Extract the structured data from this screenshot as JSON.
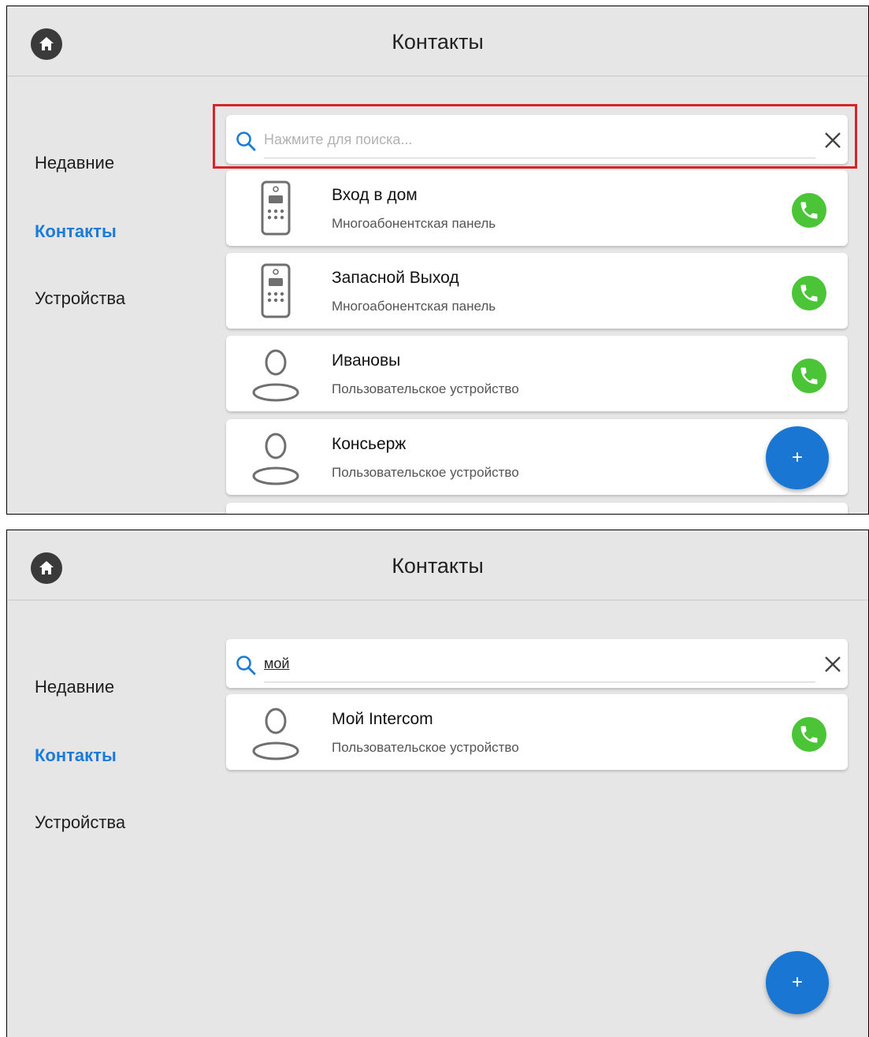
{
  "screens": [
    {
      "header": {
        "title": "Контакты"
      },
      "sidebar": {
        "items": [
          {
            "label": "Недавние",
            "active": false
          },
          {
            "label": "Контакты",
            "active": true
          },
          {
            "label": "Устройства",
            "active": false
          }
        ]
      },
      "search": {
        "placeholder": "Нажмите для поиска...",
        "value": "",
        "highlighted": true
      },
      "contacts": [
        {
          "name": "Вход в дом",
          "type": "Многоабонентская панель",
          "icon": "intercom-panel-icon",
          "call": true
        },
        {
          "name": "Запасной Выход",
          "type": "Многоабонентская панель",
          "icon": "intercom-panel-icon",
          "call": true
        },
        {
          "name": "Ивановы",
          "type": "Пользовательское устройство",
          "icon": "person-icon",
          "call": true
        },
        {
          "name": "Консьерж",
          "type": "Пользовательское устройство",
          "icon": "person-icon",
          "call": false
        }
      ],
      "fab": {
        "label": "+"
      }
    },
    {
      "header": {
        "title": "Контакты"
      },
      "sidebar": {
        "items": [
          {
            "label": "Недавние",
            "active": false
          },
          {
            "label": "Контакты",
            "active": true
          },
          {
            "label": "Устройства",
            "active": false
          }
        ]
      },
      "search": {
        "placeholder": "Нажмите для поиска...",
        "value": "мой",
        "highlighted": false
      },
      "contacts": [
        {
          "name": "Мой Intercom",
          "type": "Пользовательское устройство",
          "icon": "person-icon",
          "call": true
        }
      ],
      "fab": {
        "label": "+"
      }
    }
  ],
  "colors": {
    "accent": "#1a7cd8",
    "fab": "#1976d2",
    "call": "#4cc437",
    "highlight": "#d8232a",
    "background": "#e6e6e6",
    "home": "#3a3a3a"
  }
}
